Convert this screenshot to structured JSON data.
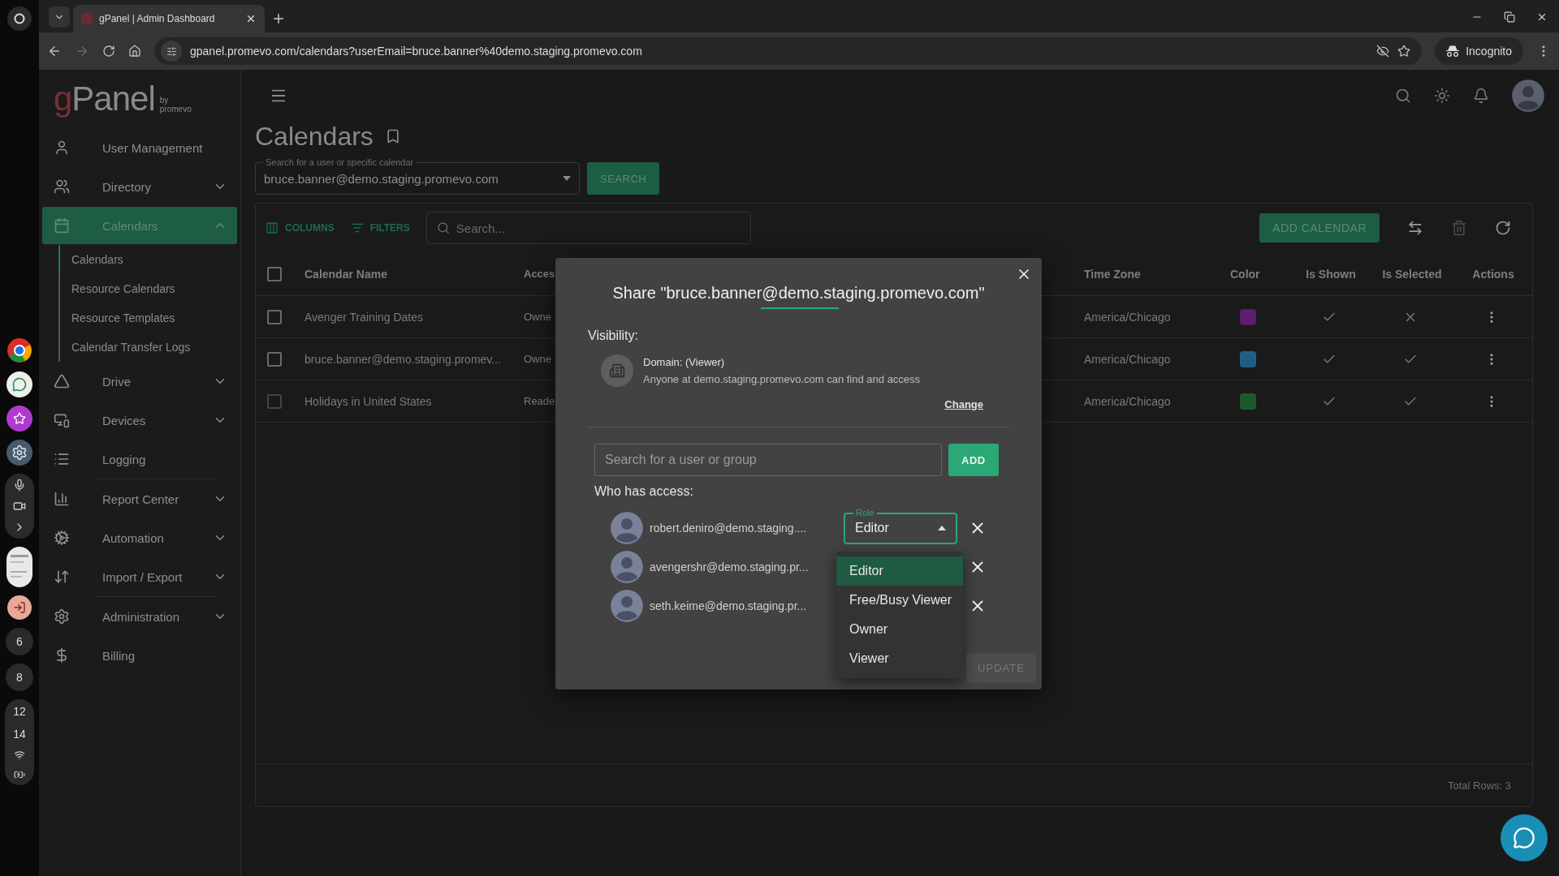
{
  "os_shelf": {
    "clock": [
      "12",
      "14"
    ],
    "badges": [
      "6",
      "8"
    ]
  },
  "browser": {
    "tab_title": "gPanel | Admin Dashboard",
    "url": "gpanel.promevo.com/calendars?userEmail=bruce.banner%40demo.staging.promevo.com",
    "profile": "Incognito"
  },
  "logo": {
    "name": "gPanel",
    "by": "by",
    "company": "promevo"
  },
  "sidebar": {
    "items": [
      {
        "kind": "item",
        "label": "User Management",
        "selected": false
      },
      {
        "kind": "group",
        "label": "Directory",
        "selected": false,
        "expanded": false
      },
      {
        "kind": "group",
        "label": "Calendars",
        "selected": true,
        "expanded": true,
        "children": [
          {
            "label": "Calendars",
            "selected": true
          },
          {
            "label": "Resource Calendars",
            "selected": false
          },
          {
            "label": "Resource Templates",
            "selected": false
          },
          {
            "label": "Calendar Transfer Logs",
            "selected": false
          }
        ]
      },
      {
        "kind": "group",
        "label": "Drive",
        "selected": false,
        "expanded": false
      },
      {
        "kind": "group",
        "label": "Devices",
        "selected": false,
        "expanded": false
      },
      {
        "kind": "item",
        "label": "Logging",
        "selected": false,
        "divider_after": true
      },
      {
        "kind": "group",
        "label": "Report Center",
        "selected": false,
        "expanded": false
      },
      {
        "kind": "group",
        "label": "Automation",
        "selected": false,
        "expanded": false
      },
      {
        "kind": "group",
        "label": "Import / Export",
        "selected": false,
        "expanded": false,
        "divider_after": true
      },
      {
        "kind": "group",
        "label": "Administration",
        "selected": false,
        "expanded": false
      },
      {
        "kind": "item",
        "label": "Billing",
        "selected": false
      }
    ]
  },
  "page": {
    "title": "Calendars",
    "search_label": "Search for a user or specific calendar",
    "search_value": "bruce.banner@demo.staging.promevo.com",
    "search_button": "SEARCH"
  },
  "table": {
    "columns_button": "COLUMNS",
    "filters_button": "FILTERS",
    "search_placeholder": "Search...",
    "add_button": "ADD CALENDAR",
    "select_all_checked": false,
    "columns": [
      "Calendar Name",
      "Acces",
      "Time Zone",
      "Color",
      "Is Shown",
      "Is Selected",
      "Actions"
    ],
    "rows": [
      {
        "name": "Avenger Training Dates",
        "access": "Owne",
        "time_zone": "America/Chicago",
        "color": "#5a1f6e",
        "is_shown": true,
        "is_selected": false,
        "checked": false,
        "disabled": false
      },
      {
        "name": "bruce.banner@demo.staging.promev...",
        "access": "Owne",
        "time_zone": "America/Chicago",
        "color": "#1f5f86",
        "is_shown": true,
        "is_selected": true,
        "checked": false,
        "disabled": false
      },
      {
        "name": "Holidays in United States",
        "access": "Reade",
        "time_zone": "America/Chicago",
        "color": "#1c5a2c",
        "is_shown": true,
        "is_selected": true,
        "checked": false,
        "disabled": true
      }
    ],
    "total_rows": "Total Rows: 3"
  },
  "modal": {
    "title": "Share \"bruce.banner@demo.staging.promevo.com\"",
    "visibility_label": "Visibility:",
    "domain_title": "Domain: (Viewer)",
    "domain_text": "Anyone at demo.staging.promevo.com can find and access",
    "change_link": "Change",
    "search_placeholder": "Search for a user or group",
    "add_button": "ADD",
    "access_label": "Who has access:",
    "members": [
      {
        "email": "robert.deniro@demo.staging....",
        "role": "Editor",
        "role_label": "Role",
        "expanded": true
      },
      {
        "email": "avengershr@demo.staging.pr..."
      },
      {
        "email": "seth.keime@demo.staging.pr..."
      }
    ],
    "role_options": [
      {
        "label": "Editor",
        "selected": true
      },
      {
        "label": "Free/Busy Viewer",
        "selected": false
      },
      {
        "label": "Owner",
        "selected": false
      },
      {
        "label": "Viewer",
        "selected": false
      }
    ],
    "update_button": "UPDATE",
    "update_disabled": true
  }
}
